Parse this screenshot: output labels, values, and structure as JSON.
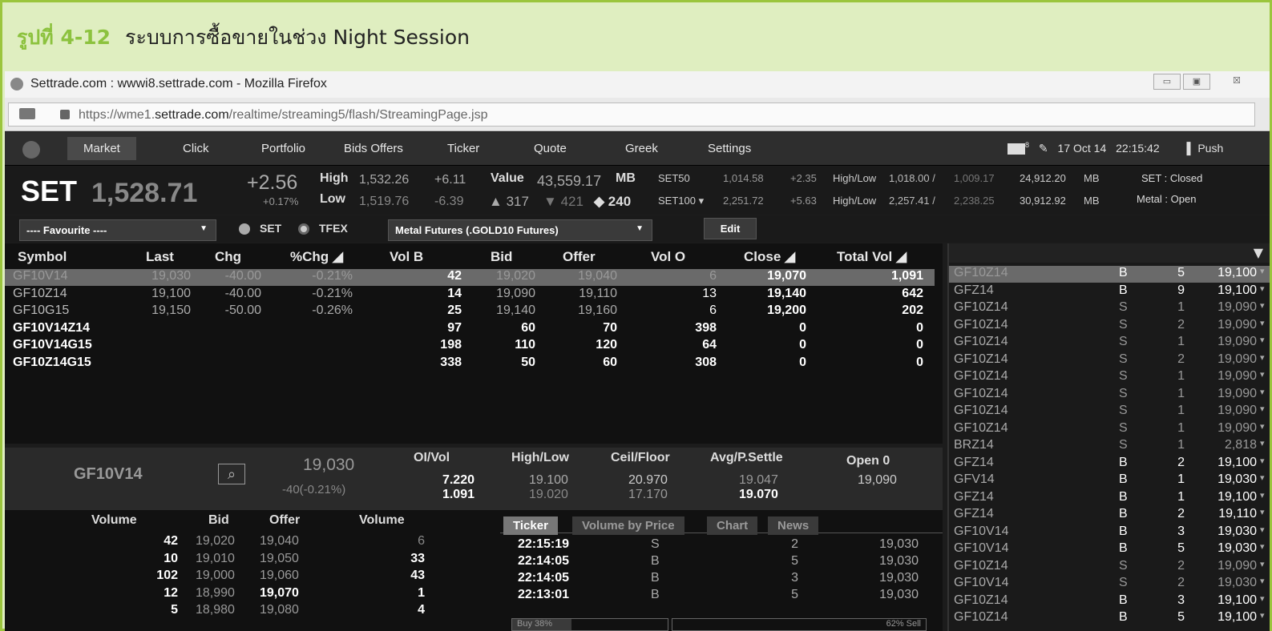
{
  "caption": {
    "label": "รูปที่ 4-12",
    "text": "ระบบการซื้อขายในช่วง Night Session"
  },
  "browser": {
    "title": "Settrade.com : wwwi8.settrade.com - Mozilla Firefox",
    "url_pre": "https://wme1.",
    "url_domain": "settrade.com",
    "url_post": "/realtime/streaming5/flash/StreamingPage.jsp",
    "btn_min": "▭",
    "btn_max": "▣",
    "btn_close": "☒"
  },
  "nav": {
    "items": [
      "Market",
      "Click",
      "Portfolio",
      "Bids Offers",
      "Ticker",
      "Quote",
      "Greek",
      "Settings"
    ],
    "mail_count": "8",
    "date": "17 Oct 14",
    "time": "22:15:42",
    "push": "Push"
  },
  "summary": {
    "set_label": "SET",
    "set_value": "1,528.71",
    "change": "+2.56",
    "change_pct": "+0.17%",
    "high_label": "High",
    "high_value": "1,532.26",
    "high_chg": "+6.11",
    "low_label": "Low",
    "low_value": "1,519.76",
    "low_chg": "-6.39",
    "value_label": "Value",
    "value_amount": "43,559.17",
    "value_unit": "MB",
    "up": "317",
    "down": "421",
    "unchanged": "240",
    "set50_label": "SET50",
    "set50_value": "1,014.58",
    "set50_chg": "+2.35",
    "set50_hl_label": "High/Low",
    "set50_high": "1,018.00 /",
    "set50_low": "1,009.17",
    "set50_vol": "24,912.20",
    "set50_unit": "MB",
    "set100_label": "SET100 ▾",
    "set100_value": "2,251.72",
    "set100_chg": "+5.63",
    "set100_hl_label": "High/Low",
    "set100_high": "2,257.41 /",
    "set100_low": "2,238.25",
    "set100_vol": "30,912.92",
    "set100_unit": "MB",
    "status_set": "SET : Closed",
    "status_metal": "Metal : Open"
  },
  "filter": {
    "favourite": "---- Favourite ----",
    "radio_set": "SET",
    "radio_tfex": "TFEX",
    "market": "Metal Futures (.GOLD10 Futures)",
    "edit": "Edit"
  },
  "table": {
    "headers": [
      "Symbol",
      "Last",
      "Chg",
      "%Chg ◢",
      "Vol B",
      "Bid",
      "Offer",
      "Vol O",
      "Close ◢",
      "Total Vol ◢"
    ],
    "rows": [
      {
        "symbol": "GF10V14",
        "last": "19,030",
        "chg": "-40.00",
        "pct": "-0.21%",
        "volb": "42",
        "bid": "19,020",
        "offer": "19,040",
        "volo": "6",
        "close": "19,070",
        "total": "1,091"
      },
      {
        "symbol": "GF10Z14",
        "last": "19,100",
        "chg": "-40.00",
        "pct": "-0.21%",
        "volb": "14",
        "bid": "19,090",
        "offer": "19,110",
        "volo": "13",
        "close": "19,140",
        "total": "642"
      },
      {
        "symbol": "GF10G15",
        "last": "19,150",
        "chg": "-50.00",
        "pct": "-0.26%",
        "volb": "25",
        "bid": "19,140",
        "offer": "19,160",
        "volo": "6",
        "close": "19,200",
        "total": "202"
      },
      {
        "symbol": "GF10V14Z14",
        "last": "",
        "chg": "",
        "pct": "",
        "volb": "97",
        "bid": "60",
        "offer": "70",
        "volo": "398",
        "close": "0",
        "total": "0"
      },
      {
        "symbol": "GF10V14G15",
        "last": "",
        "chg": "",
        "pct": "",
        "volb": "198",
        "bid": "110",
        "offer": "120",
        "volo": "64",
        "close": "0",
        "total": "0"
      },
      {
        "symbol": "GF10Z14G15",
        "last": "",
        "chg": "",
        "pct": "",
        "volb": "338",
        "bid": "50",
        "offer": "60",
        "volo": "308",
        "close": "0",
        "total": "0"
      }
    ]
  },
  "detail": {
    "symbol": "GF10V14",
    "search_icon": "⌕",
    "last": "19,030",
    "chg": "-40(-0.21%)",
    "oivol_label": "OI/Vol",
    "oi": "7.220",
    "vol": "1.091",
    "hl_label": "High/Low",
    "high": "19.100",
    "low": "19.020",
    "cf_label": "Ceil/Floor",
    "ceil": "20.970",
    "floor": "17.170",
    "avg_label": "Avg/P.Settle",
    "avg": "19.047",
    "settle": "19.070",
    "open_label": "Open 0",
    "open": "19,090"
  },
  "book": {
    "headers": [
      "Volume",
      "Bid",
      "Offer",
      "Volume"
    ],
    "rows": [
      [
        "42",
        "19,020",
        "19,040",
        "6"
      ],
      [
        "10",
        "19,010",
        "19,050",
        "33"
      ],
      [
        "102",
        "19,000",
        "19,060",
        "43"
      ],
      [
        "12",
        "18,990",
        "19,070",
        "1"
      ],
      [
        "5",
        "18,980",
        "19,080",
        "4"
      ]
    ]
  },
  "ticker": {
    "tabs": [
      "Ticker",
      "Volume by Price",
      "Chart",
      "News"
    ],
    "rows": [
      [
        "22:15:19",
        "S",
        "2",
        "19,030"
      ],
      [
        "22:14:05",
        "B",
        "5",
        "19,030"
      ],
      [
        "22:14:05",
        "B",
        "3",
        "19,030"
      ],
      [
        "22:13:01",
        "B",
        "5",
        "19,030"
      ]
    ],
    "buy": "Buy  38%",
    "sell": "62%  Sell",
    "buy_ratio": 0.38
  },
  "side": {
    "filter_icon": "▼",
    "rows": [
      [
        "GF10Z14",
        "B",
        "5",
        "19,100"
      ],
      [
        "GFZ14",
        "B",
        "9",
        "19,100"
      ],
      [
        "GF10Z14",
        "S",
        "1",
        "19,090"
      ],
      [
        "GF10Z14",
        "S",
        "2",
        "19,090"
      ],
      [
        "GF10Z14",
        "S",
        "1",
        "19,090"
      ],
      [
        "GF10Z14",
        "S",
        "2",
        "19,090"
      ],
      [
        "GF10Z14",
        "S",
        "1",
        "19,090"
      ],
      [
        "GF10Z14",
        "S",
        "1",
        "19,090"
      ],
      [
        "GF10Z14",
        "S",
        "1",
        "19,090"
      ],
      [
        "GF10Z14",
        "S",
        "1",
        "19,090"
      ],
      [
        "BRZ14",
        "S",
        "1",
        "2,818"
      ],
      [
        "GFZ14",
        "B",
        "2",
        "19,100"
      ],
      [
        "GFV14",
        "B",
        "1",
        "19,030"
      ],
      [
        "GFZ14",
        "B",
        "1",
        "19,100"
      ],
      [
        "GFZ14",
        "B",
        "2",
        "19,110"
      ],
      [
        "GF10V14",
        "B",
        "3",
        "19,030"
      ],
      [
        "GF10V14",
        "B",
        "5",
        "19,030"
      ],
      [
        "GF10Z14",
        "S",
        "2",
        "19,090"
      ],
      [
        "GF10V14",
        "S",
        "2",
        "19,030"
      ],
      [
        "GF10Z14",
        "B",
        "3",
        "19,100"
      ],
      [
        "GF10Z14",
        "B",
        "5",
        "19,100"
      ]
    ]
  }
}
